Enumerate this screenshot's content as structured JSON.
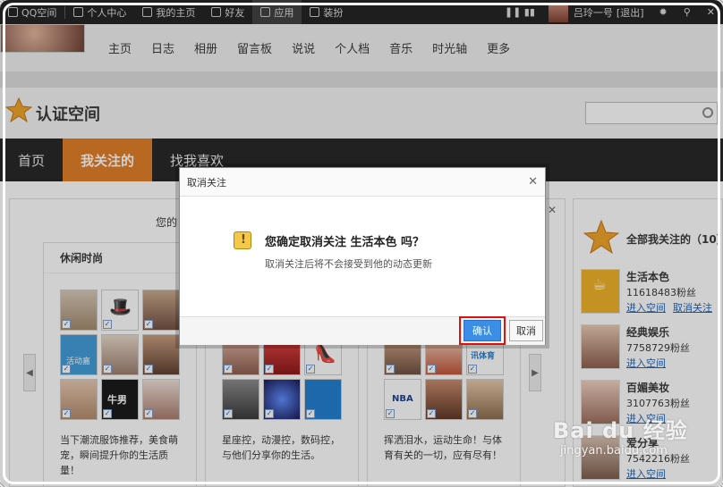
{
  "topbar": {
    "items": [
      "QQ空间",
      "个人中心",
      "我的主页",
      "好友",
      "应用",
      "装扮"
    ],
    "user_name": "吕玲一号",
    "user_tag": "[退出]"
  },
  "nav": [
    "主页",
    "日志",
    "相册",
    "留言板",
    "说说",
    "个人档",
    "音乐",
    "时光轴",
    "更多"
  ],
  "header": {
    "title": "认证空间"
  },
  "tabs": [
    "首页",
    "我关注的",
    "找我喜欢"
  ],
  "content": {
    "hint_prefix": "您的",
    "cards": [
      {
        "title": "休闲时尚",
        "desc": "当下潮流服饰推荐，美食萌宠，瞬间提升你的生活质量！"
      },
      {
        "title": "",
        "desc": "星座控，动漫控，数码控，与他们分享你的生活。"
      },
      {
        "title": "",
        "desc": "挥洒泪水，运动生命！与体育有关的一切，应有尽有！"
      }
    ],
    "thumb_labels": {
      "huodong": "活动嘉",
      "niunan": "牛男",
      "nba": "NBA",
      "tiyu": "讯体育"
    }
  },
  "sidebar": {
    "title": "全部我关注的（10）",
    "follows": [
      {
        "name": "生活本色",
        "fans": "11618483粉丝",
        "links": [
          "进入空间",
          "取消关注"
        ]
      },
      {
        "name": "经典娱乐",
        "fans": "7758729粉丝",
        "links": [
          "进入空间"
        ]
      },
      {
        "name": "百媚美妆",
        "fans": "3107763粉丝",
        "links": [
          "进入空间"
        ]
      },
      {
        "name": "爱分享",
        "fans": "7542216粉丝",
        "links": [
          "进入空间"
        ]
      }
    ]
  },
  "dialog": {
    "title": "取消关注",
    "question": "您确定取消关注 生活本色 吗？",
    "sub": "取消关注后将不会接受到他的动态更新",
    "ok": "确认",
    "cancel": "取消"
  },
  "watermark": {
    "line1": "Bai du 经验",
    "line2": "jingyan.baidu.com"
  },
  "colors": {
    "accent": "#e07a1e",
    "primary_button": "#3a8ee6",
    "highlight": "#e01010"
  }
}
